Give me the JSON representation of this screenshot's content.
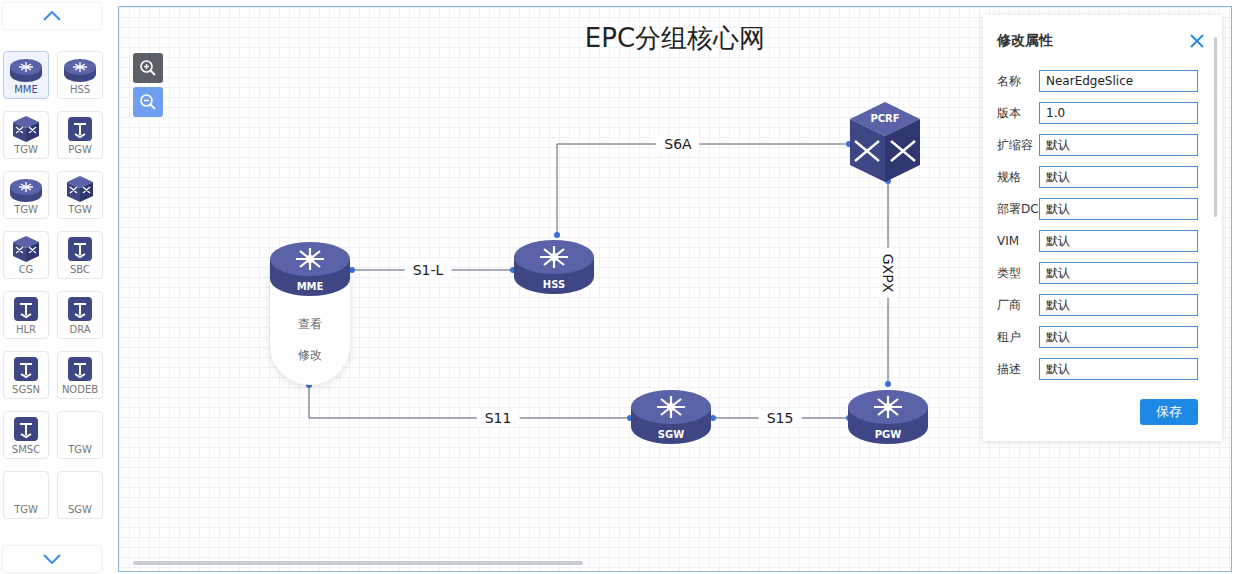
{
  "window": {
    "title": "EPC分组核心网"
  },
  "palette": [
    {
      "label": "MME",
      "kind": "round",
      "selected": true
    },
    {
      "label": "HSS",
      "kind": "round",
      "selected": false
    },
    {
      "label": "TGW",
      "kind": "cube",
      "selected": false
    },
    {
      "label": "PGW",
      "kind": "square",
      "selected": false
    },
    {
      "label": "TGW",
      "kind": "round",
      "selected": false
    },
    {
      "label": "TGW",
      "kind": "cube",
      "selected": false
    },
    {
      "label": "CG",
      "kind": "cube",
      "selected": false
    },
    {
      "label": "SBC",
      "kind": "square",
      "selected": false
    },
    {
      "label": "HLR",
      "kind": "square",
      "selected": false
    },
    {
      "label": "DRA",
      "kind": "square",
      "selected": false
    },
    {
      "label": "SGSN",
      "kind": "square",
      "selected": false
    },
    {
      "label": "NODEB",
      "kind": "square",
      "selected": false
    },
    {
      "label": "SMSC",
      "kind": "square",
      "selected": false
    },
    {
      "label": "TGW",
      "kind": "blank",
      "selected": false
    },
    {
      "label": "TGW",
      "kind": "blank",
      "selected": false
    },
    {
      "label": "SGW",
      "kind": "blank",
      "selected": false
    }
  ],
  "zoom": [
    {
      "kind": "in",
      "active": false
    },
    {
      "kind": "out",
      "active": true
    }
  ],
  "nodes": [
    {
      "label": "MME",
      "kind": "round"
    },
    {
      "label": "HSS",
      "kind": "round"
    },
    {
      "label": "PCRF",
      "kind": "cube"
    },
    {
      "label": "SGW",
      "kind": "round"
    },
    {
      "label": "PGW",
      "kind": "round"
    }
  ],
  "links": [
    {
      "label": "S1-L",
      "vertical": false
    },
    {
      "label": "S6A",
      "vertical": false
    },
    {
      "label": "GXPX",
      "vertical": true
    },
    {
      "label": "S11",
      "vertical": false
    },
    {
      "label": "S15",
      "vertical": false
    }
  ],
  "context_menu": [
    "查看",
    "修改"
  ],
  "panel": {
    "title": "修改属性",
    "fields": [
      {
        "label": "名称",
        "value": "NearEdgeSlice"
      },
      {
        "label": "版本",
        "value": "1.0"
      },
      {
        "label": "扩缩容",
        "value": "默认"
      },
      {
        "label": "规格",
        "value": "默认"
      },
      {
        "label": "部署DC",
        "value": "默认"
      },
      {
        "label": "VIM",
        "value": "默认"
      },
      {
        "label": "类型",
        "value": "默认"
      },
      {
        "label": "厂商",
        "value": "默认"
      },
      {
        "label": "租户",
        "value": "默认"
      },
      {
        "label": "描述",
        "value": "默认"
      }
    ],
    "button": "保存"
  }
}
